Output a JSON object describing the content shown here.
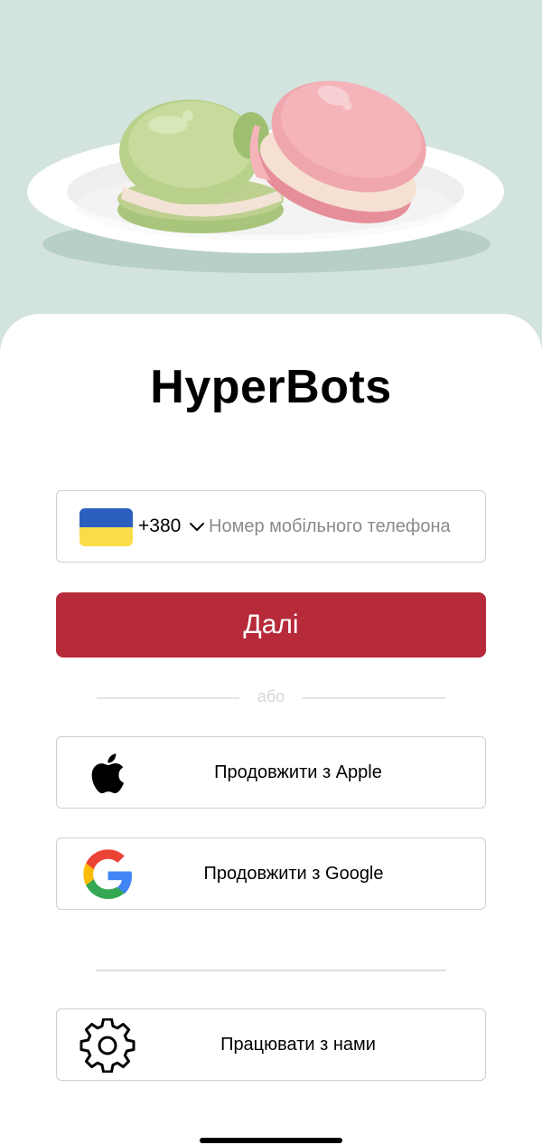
{
  "app": {
    "title": "HyperBots"
  },
  "colors": {
    "hero_bg": "#d3e4df",
    "primary": "#b62a3a",
    "flag_blue": "#2b5fbf",
    "flag_yellow": "#fadc48"
  },
  "phone": {
    "country_flag": "ukraine-flag-icon",
    "dial_code": "+380",
    "placeholder": "Номер мобільного телефона",
    "value": ""
  },
  "next_button": {
    "label": "Далі"
  },
  "divider": {
    "label": "або"
  },
  "social": {
    "apple": {
      "label": "Продовжити з Apple",
      "icon": "apple-icon"
    },
    "google": {
      "label": "Продовжити з Google",
      "icon": "google-icon"
    }
  },
  "work_with_us": {
    "label": "Працювати з нами",
    "icon": "gear-icon"
  }
}
